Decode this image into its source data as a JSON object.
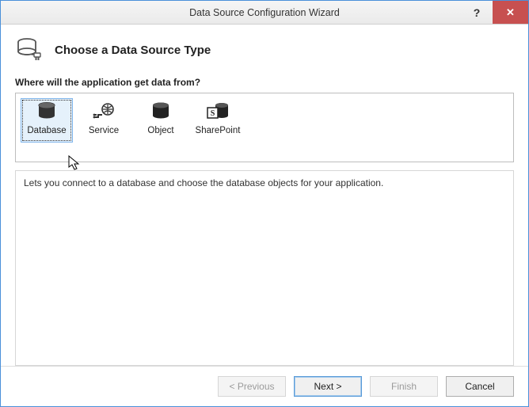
{
  "window": {
    "title": "Data Source Configuration Wizard",
    "help_label": "?",
    "close_label": "✕"
  },
  "header": {
    "heading": "Choose a Data Source Type"
  },
  "prompt": "Where will the application get data from?",
  "options": {
    "database": "Database",
    "service": "Service",
    "object": "Object",
    "sharepoint": "SharePoint"
  },
  "description": "Lets you connect to a database and choose the database objects for your application.",
  "footer": {
    "previous": "< Previous",
    "next": "Next >",
    "finish": "Finish",
    "cancel": "Cancel"
  }
}
